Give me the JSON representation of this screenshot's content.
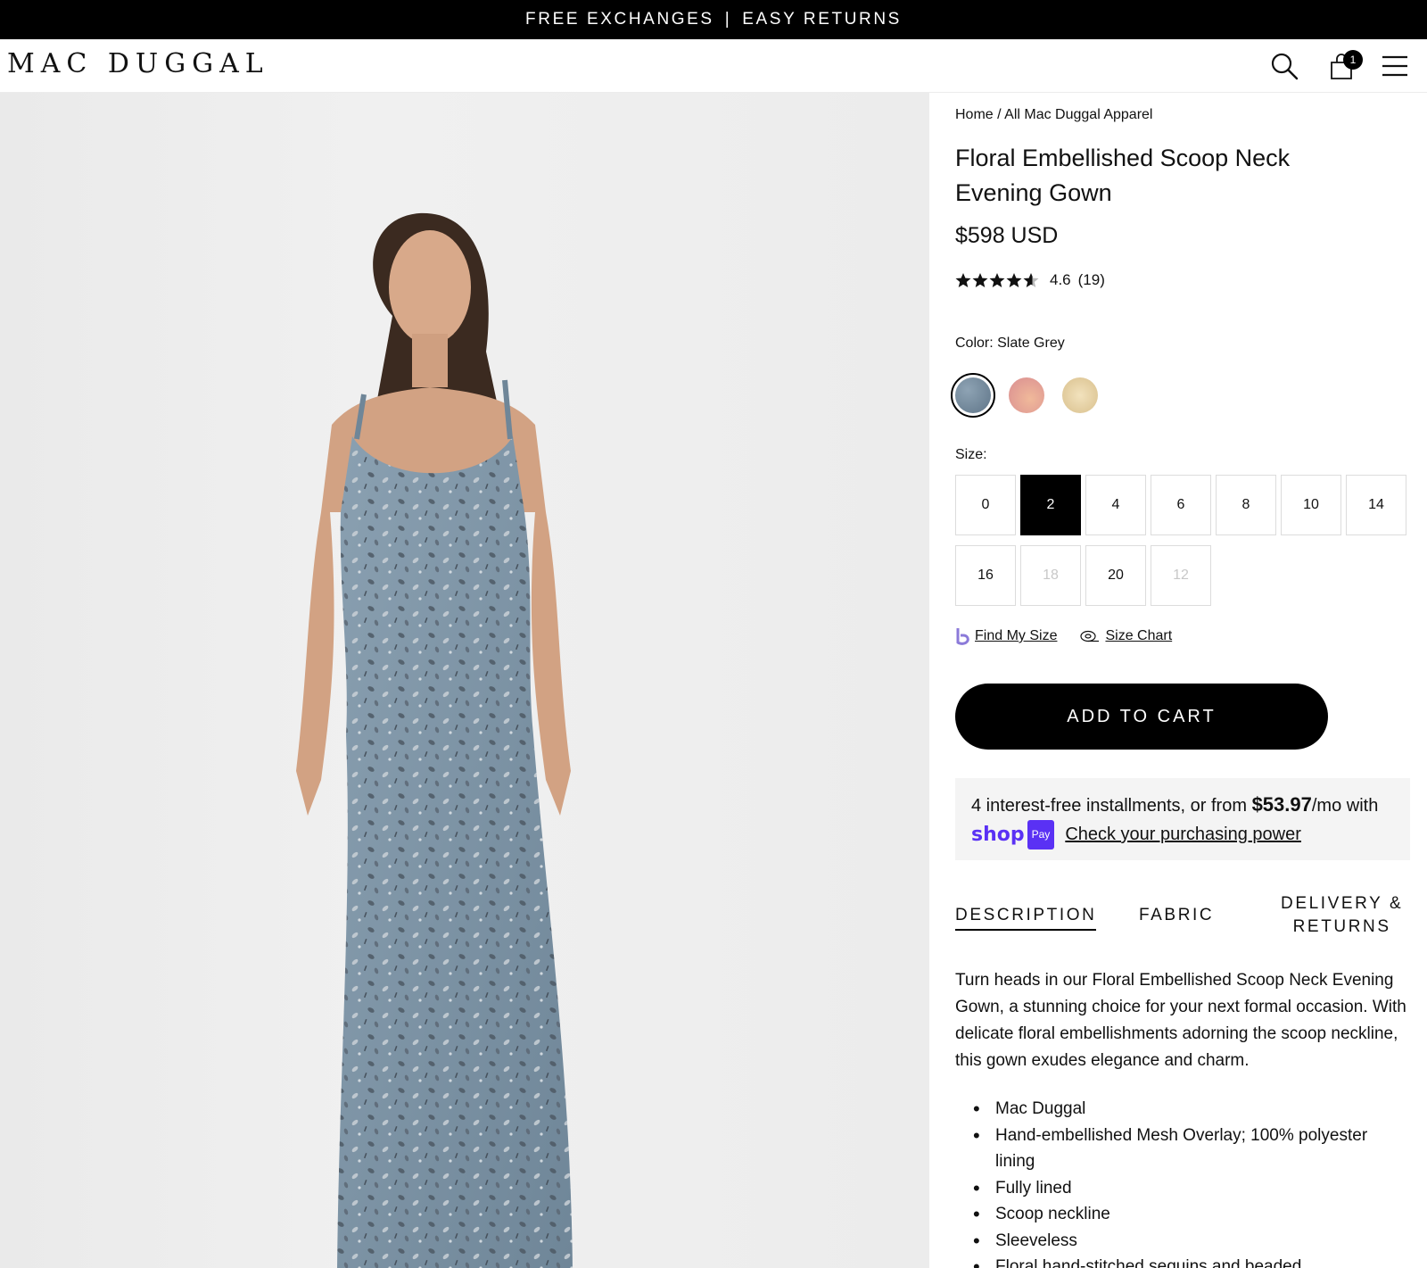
{
  "announcement": {
    "left": "FREE EXCHANGES",
    "separator": "|",
    "right": "EASY RETURNS"
  },
  "header": {
    "logo": "MAC DUGGAL",
    "cart_count": "1"
  },
  "breadcrumb": {
    "home": "Home",
    "separator": "/",
    "current": "All Mac Duggal Apparel"
  },
  "product": {
    "title": "Floral Embellished Scoop Neck Evening Gown",
    "price": "$598 USD",
    "rating_value": "4.6",
    "rating_count": "(19)",
    "color_label": "Color: Slate Grey",
    "size_label": "Size:",
    "swatches": [
      {
        "name": "Slate Grey",
        "color": "#6d8497",
        "selected": true
      },
      {
        "name": "Blush",
        "color": "#e6a79a",
        "selected": false
      },
      {
        "name": "Champagne",
        "color": "#ecd7a8",
        "selected": false
      }
    ],
    "sizes": [
      "0",
      "2",
      "4",
      "6",
      "8",
      "10",
      "14",
      "16",
      "18",
      "20",
      "12"
    ],
    "selected_size": "2",
    "disabled_sizes": [
      "18",
      "12"
    ]
  },
  "links": {
    "find_size": "Find My Size",
    "size_chart": "Size Chart"
  },
  "add_to_cart": "ADD TO CART",
  "shoppay": {
    "prefix": "4 interest-free installments, or from",
    "amount": "$53.97",
    "suffix": "/mo with",
    "logo_shop": "shop",
    "logo_pay": "Pay",
    "link": "Check your purchasing power"
  },
  "tabs": {
    "description": "DESCRIPTION",
    "fabric": "FABRIC",
    "delivery_line1": "DELIVERY &",
    "delivery_line2": "RETURNS"
  },
  "description": "Turn heads in our Floral Embellished Scoop Neck Evening Gown, a stunning choice for your next formal occasion. With delicate floral embellishments adorning the scoop neckline, this gown exudes elegance and charm.",
  "bullets": [
    "Mac Duggal",
    "Hand-embellished Mesh Overlay; 100% polyester lining",
    "Fully lined",
    "Scoop neckline",
    "Sleeveless",
    "Floral hand-stitched sequins and beaded"
  ],
  "colors": {
    "accent": "#000000",
    "shoppay": "#5a31f4",
    "dress": "#7f96a8"
  }
}
